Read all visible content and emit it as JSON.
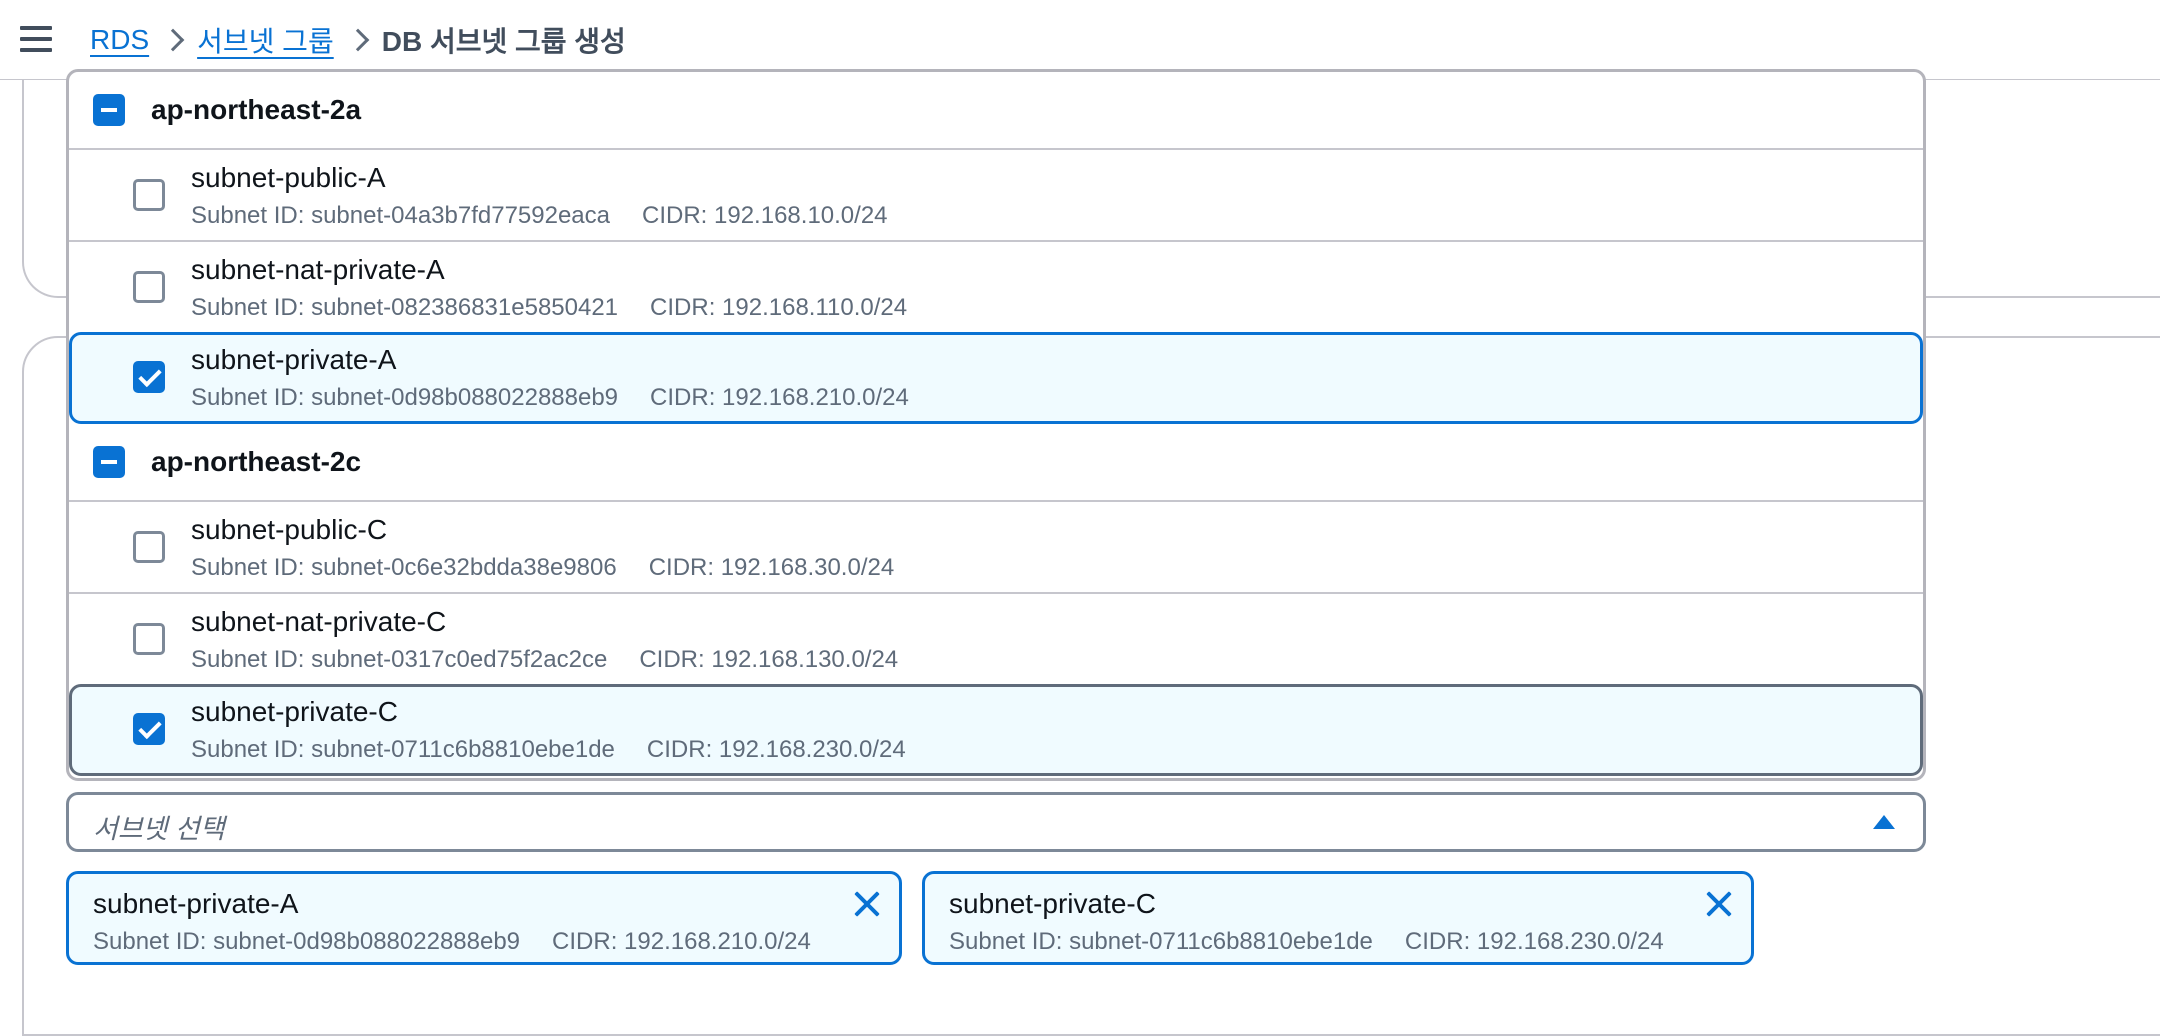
{
  "breadcrumb": {
    "items": [
      "RDS",
      "서브넷 그룹"
    ],
    "current": "DB 서브넷 그룹 생성"
  },
  "dropdown": {
    "groups": [
      {
        "label": "ap-northeast-2a",
        "state": "indeterminate",
        "options": [
          {
            "name": "subnet-public-A",
            "subnet_id": "Subnet ID: subnet-04a3b7fd77592eaca",
            "cidr": "CIDR: 192.168.10.0/24",
            "checked": false
          },
          {
            "name": "subnet-nat-private-A",
            "subnet_id": "Subnet ID: subnet-082386831e5850421",
            "cidr": "CIDR: 192.168.110.0/24",
            "checked": false
          },
          {
            "name": "subnet-private-A",
            "subnet_id": "Subnet ID: subnet-0d98b088022888eb9",
            "cidr": "CIDR: 192.168.210.0/24",
            "checked": true
          }
        ]
      },
      {
        "label": "ap-northeast-2c",
        "state": "indeterminate",
        "options": [
          {
            "name": "subnet-public-C",
            "subnet_id": "Subnet ID: subnet-0c6e32bdda38e9806",
            "cidr": "CIDR: 192.168.30.0/24",
            "checked": false
          },
          {
            "name": "subnet-nat-private-C",
            "subnet_id": "Subnet ID: subnet-0317c0ed75f2ac2ce",
            "cidr": "CIDR: 192.168.130.0/24",
            "checked": false
          },
          {
            "name": "subnet-private-C",
            "subnet_id": "Subnet ID: subnet-0711c6b8810ebe1de",
            "cidr": "CIDR: 192.168.230.0/24",
            "checked": true
          }
        ]
      }
    ]
  },
  "select": {
    "placeholder": "서브넷 선택"
  },
  "tokens": [
    {
      "name": "subnet-private-A",
      "subnet_id": "Subnet ID: subnet-0d98b088022888eb9",
      "cidr": "CIDR: 192.168.210.0/24"
    },
    {
      "name": "subnet-private-C",
      "subnet_id": "Subnet ID: subnet-0711c6b8810ebe1de",
      "cidr": "CIDR: 192.168.230.0/24"
    }
  ],
  "colors": {
    "accent": "#0972d3",
    "selected_bg": "#f0fbff",
    "text": "#0f141a",
    "muted": "#5f6b7a",
    "border": "#c6c6cd"
  },
  "icons": {
    "menu": "hamburger-menu-icon",
    "separator": "chevron-right-icon",
    "caret": "caret-up-icon",
    "dismiss": "close-icon"
  }
}
